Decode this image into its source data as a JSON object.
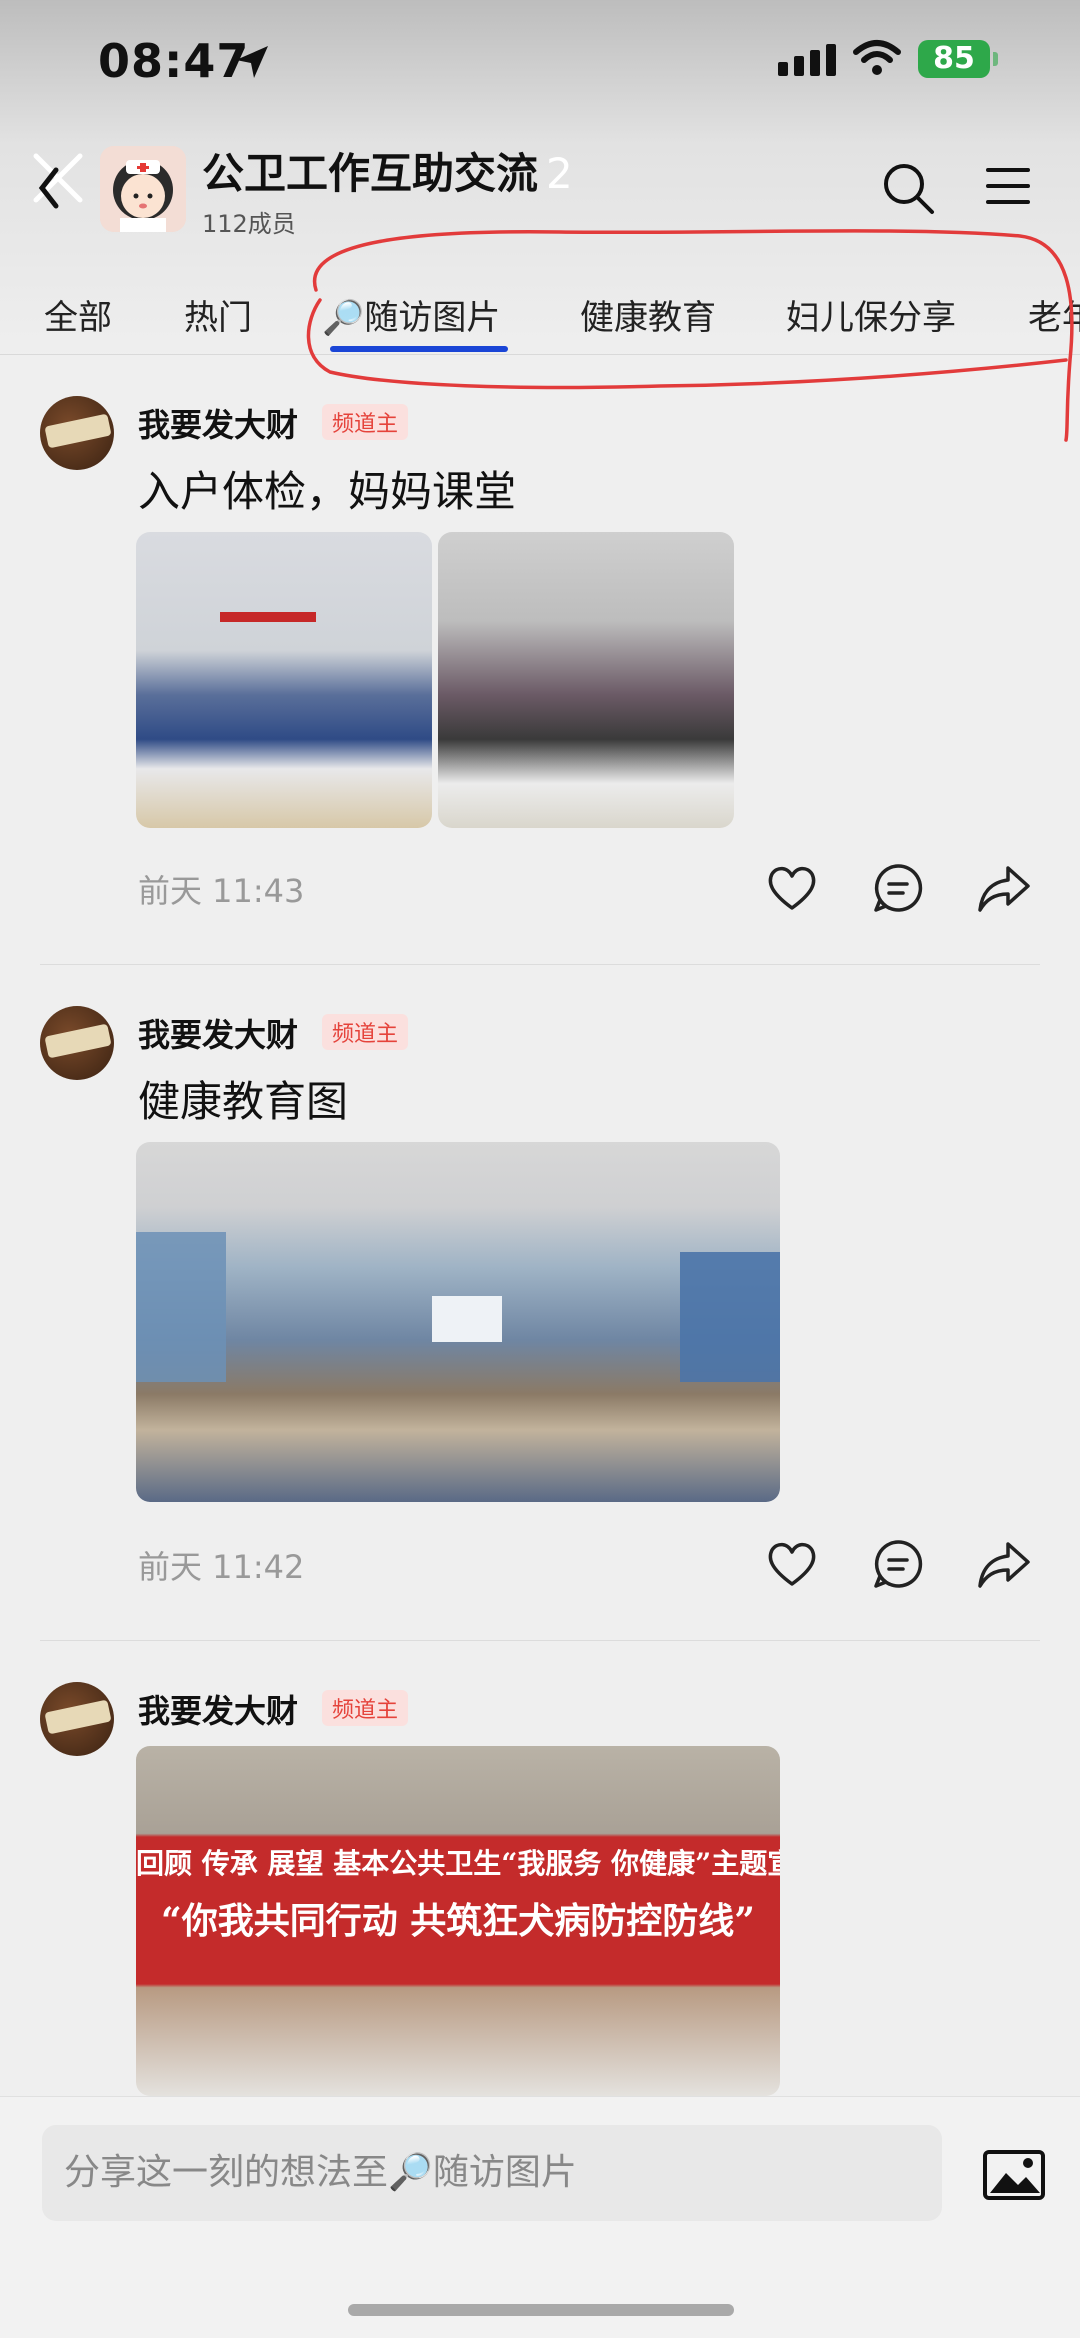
{
  "status_bar": {
    "time": "08:47",
    "battery": "85"
  },
  "header": {
    "group_name": "公卫工作互助交流",
    "badge_count": "2",
    "members": "112成员"
  },
  "tabs": [
    {
      "label": "全部"
    },
    {
      "label": "热门"
    },
    {
      "label": "🔎随访图片"
    },
    {
      "label": "健康教育"
    },
    {
      "label": "妇儿保分享"
    },
    {
      "label": "老年"
    }
  ],
  "posts": [
    {
      "author": "我要发大财",
      "role": "频道主",
      "text": "入户体检，妈妈课堂",
      "time": "前天 11:43"
    },
    {
      "author": "我要发大财",
      "role": "频道主",
      "text": "健康教育图",
      "time": "前天 11:42"
    },
    {
      "author": "我要发大财",
      "role": "频道主",
      "banner_line1": "回顾 传承 展望 基本公共卫生“我服务 你健康”主题宣传月活动",
      "banner_line2": "“你我共同行动 共筑狂犬病防控防线”"
    }
  ],
  "composer": {
    "placeholder": "分享这一刻的想法至🔎随访图片"
  },
  "colors": {
    "accent": "#1a45d6",
    "role_badge": "#e5433b",
    "battery": "#2ea84a"
  }
}
